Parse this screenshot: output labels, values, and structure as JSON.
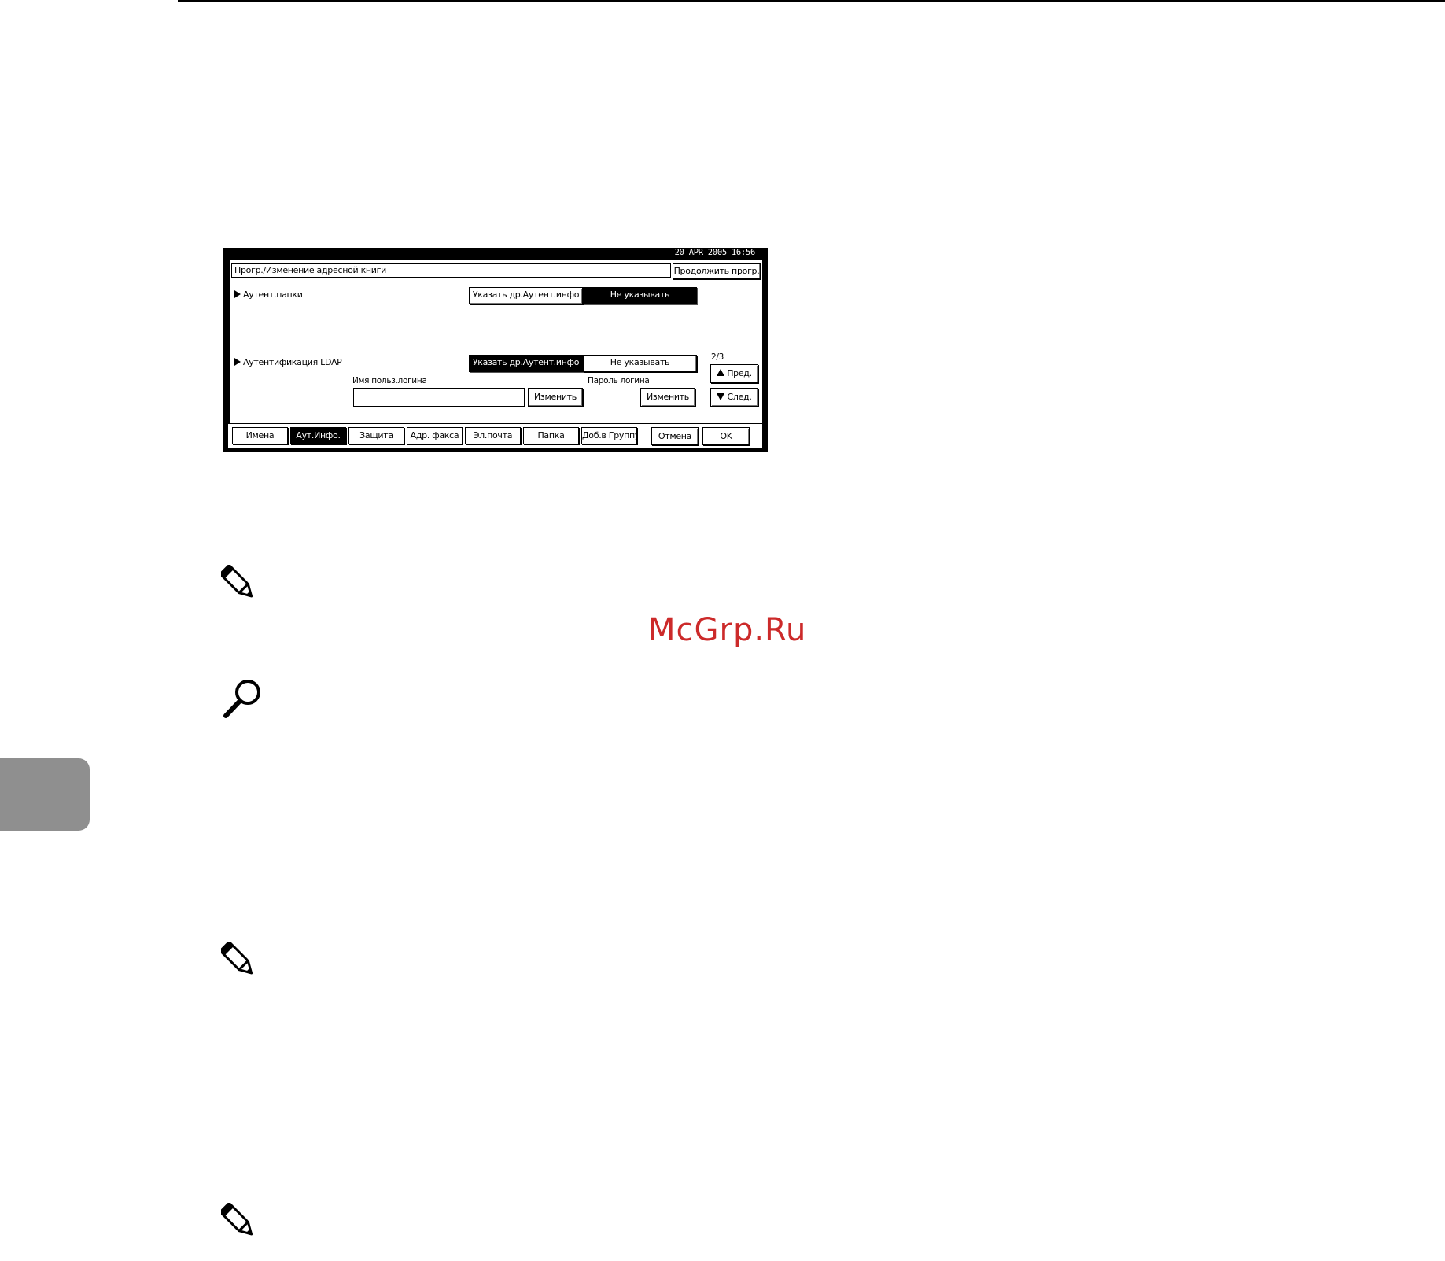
{
  "screen": {
    "datetime": "20 APR  2005 16:56",
    "title": "Прогр./Изменение адресной книги",
    "continue_button": "Продолжить прогр.",
    "folder_auth": {
      "label": "Аутент.папки",
      "specify_button": "Указать др.Аутент.инфо",
      "do_not_specify_button": "Не указывать",
      "selected": "do_not_specify"
    },
    "ldap_auth": {
      "label": "Аутентификация LDAP",
      "specify_button": "Указать др.Аутент.инфо",
      "do_not_specify_button": "Не указывать",
      "selected": "specify",
      "login_user_name_label": "Имя польз.логина",
      "login_user_name_value": "",
      "change_user_button": "Изменить",
      "login_password_label": "Пароль логина",
      "change_password_button": "Изменить"
    },
    "pager": {
      "page_indicator": "2/3",
      "prev_button": "Пред.",
      "next_button": "След."
    },
    "tabs": [
      {
        "label": "Имена",
        "active": false
      },
      {
        "label": "Аут.Инфо.",
        "active": true
      },
      {
        "label": "Защита",
        "active": false
      },
      {
        "label": "Адр. факса",
        "active": false
      },
      {
        "label": "Эл.почта",
        "active": false
      },
      {
        "label": "Папка",
        "active": false
      },
      {
        "label": "Доб.в Группу",
        "active": false
      }
    ],
    "cancel_button": "Отмена",
    "ok_button": "OK"
  },
  "page": {
    "watermark": "McGrp.Ru",
    "icons": [
      "note-pencil-icon",
      "reference-magnifier-icon",
      "note-pencil-icon",
      "note-pencil-icon"
    ]
  }
}
